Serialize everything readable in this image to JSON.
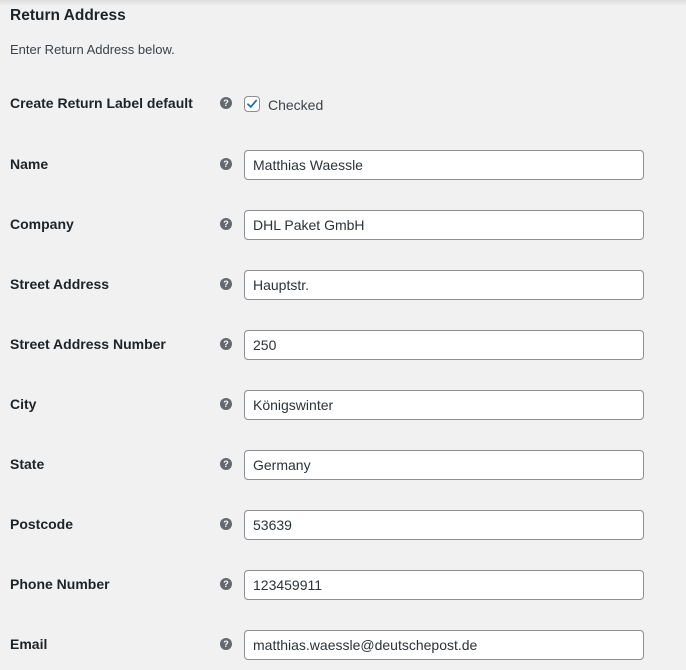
{
  "section": {
    "title": "Return Address",
    "description": "Enter Return Address below."
  },
  "help_icon_glyph": "?",
  "create_return_label": {
    "label": "Create Return Label default",
    "checked": true,
    "checkbox_text": "Checked"
  },
  "fields": [
    {
      "label": "Name",
      "value": "Matthias Waessle"
    },
    {
      "label": "Company",
      "value": "DHL Paket GmbH"
    },
    {
      "label": "Street Address",
      "value": "Hauptstr."
    },
    {
      "label": "Street Address Number",
      "value": "250"
    },
    {
      "label": "City",
      "value": "Königswinter"
    },
    {
      "label": "State",
      "value": "Germany"
    },
    {
      "label": "Postcode",
      "value": "53639"
    },
    {
      "label": "Phone Number",
      "value": "123459911"
    },
    {
      "label": "Email",
      "value": "matthias.waessle@deutschepost.de"
    }
  ],
  "colors": {
    "background": "#f1f1f1",
    "checkmark": "#2271b1",
    "help_icon": "#646970"
  }
}
